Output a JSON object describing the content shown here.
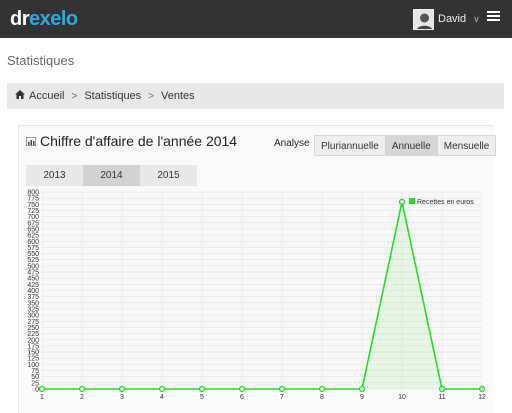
{
  "header": {
    "logo_part1": "dr",
    "logo_part2": "exelo",
    "user_name": "David",
    "user_chevron": "∨"
  },
  "page": {
    "title": "Statistiques"
  },
  "breadcrumb": {
    "home_icon": "home-icon",
    "items": [
      "Accueil",
      "Statistiques",
      "Ventes"
    ],
    "separator": ">"
  },
  "panel": {
    "title": "Chiffre d'affaire de l'année 2014",
    "analyse_label": "Analyse",
    "modes": [
      "Pluriannuelle",
      "Annuelle",
      "Mensuelle"
    ],
    "active_mode": "Annuelle",
    "years": [
      "2013",
      "2014",
      "2015"
    ],
    "active_year": "2014"
  },
  "colors": {
    "topbar": "#333333",
    "logo_accent": "#29abe2",
    "series_line": "#22dd22"
  },
  "chart_data": {
    "type": "line",
    "x": [
      1,
      2,
      3,
      4,
      5,
      6,
      7,
      8,
      9,
      10,
      11,
      12
    ],
    "series": [
      {
        "name": "Recettes en euros",
        "values": [
          0,
          0,
          0,
          0,
          0,
          0,
          0,
          0,
          0,
          760,
          0,
          0
        ]
      }
    ],
    "ylim": [
      0,
      800
    ],
    "y_ticks": [
      0,
      25,
      50,
      75,
      100,
      125,
      150,
      175,
      200,
      225,
      250,
      275,
      300,
      325,
      350,
      375,
      400,
      425,
      450,
      475,
      500,
      525,
      550,
      575,
      600,
      625,
      650,
      675,
      700,
      725,
      750,
      775,
      800
    ],
    "legend_position": "top-right",
    "grid": true
  }
}
